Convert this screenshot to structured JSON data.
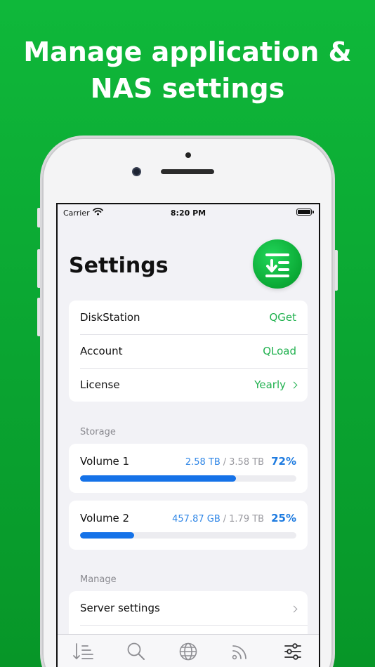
{
  "headline": {
    "line1": "Manage application &",
    "line2": "NAS settings"
  },
  "status_bar": {
    "carrier": "Carrier",
    "time": "8:20 PM"
  },
  "page": {
    "title": "Settings"
  },
  "account_rows": [
    {
      "label": "DiskStation",
      "value": "QGet"
    },
    {
      "label": "Account",
      "value": "QLoad"
    },
    {
      "label": "License",
      "value": "Yearly"
    }
  ],
  "storage": {
    "header": "Storage",
    "volumes": [
      {
        "name": "Volume 1",
        "used": "2.58 TB",
        "separator": "/",
        "total": "3.58 TB",
        "percent_label": "72%",
        "fraction": 0.72
      },
      {
        "name": "Volume 2",
        "used": "457.87 GB",
        "separator": "/",
        "total": "1.79 TB",
        "percent_label": "25%",
        "fraction": 0.25
      }
    ]
  },
  "manage": {
    "header": "Manage",
    "rows": [
      {
        "label": "Server settings"
      }
    ]
  },
  "tabs": [
    {
      "icon": "sort-icon"
    },
    {
      "icon": "search-icon"
    },
    {
      "icon": "globe-icon"
    },
    {
      "icon": "rss-icon"
    },
    {
      "icon": "sliders-icon"
    }
  ],
  "colors": {
    "brand_green": "#0aa834",
    "accent_green": "#21b14f",
    "progress_blue": "#1572e8"
  }
}
